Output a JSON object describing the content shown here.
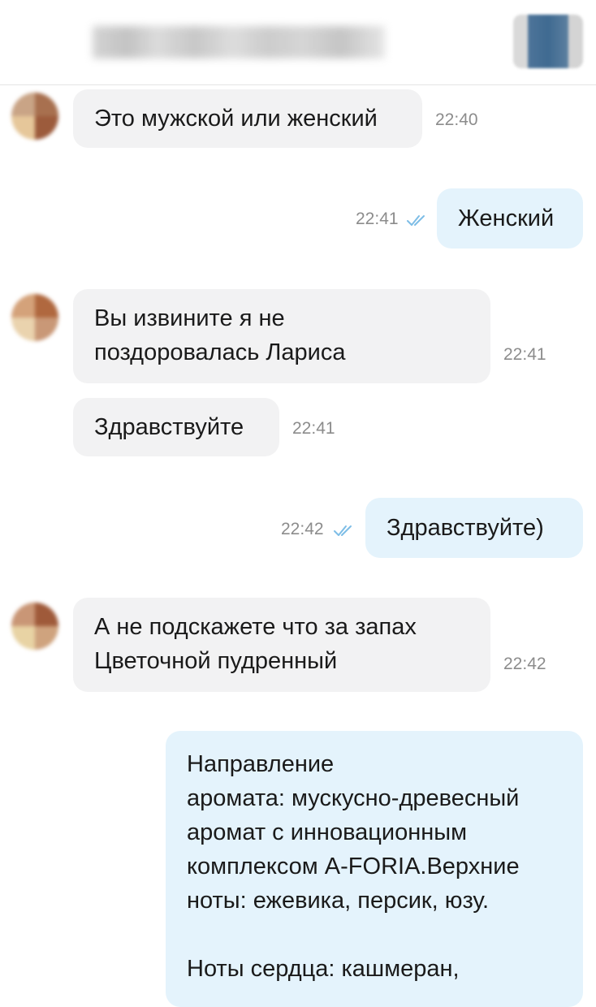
{
  "header": {
    "title_blurred": "",
    "avatar": "blurred-contact-avatar"
  },
  "messages": [
    {
      "id": "m1",
      "direction": "in",
      "text": "Это мужской или женский",
      "time": "22:40"
    },
    {
      "id": "m2",
      "direction": "out",
      "text": "Женский",
      "time": "22:41",
      "read_icon": "double-check-icon"
    },
    {
      "id": "m3",
      "direction": "in",
      "text": "Вы извините я не\nпоздоровалась Лариса",
      "time": "22:41"
    },
    {
      "id": "m4",
      "direction": "in",
      "text": "Здравствуйте",
      "time": "22:41"
    },
    {
      "id": "m5",
      "direction": "out",
      "text": "Здравствуйте)",
      "time": "22:42",
      "read_icon": "double-check-icon"
    },
    {
      "id": "m6",
      "direction": "in",
      "text": "А не подскажете что за запах\nЦветочной пудренный",
      "time": "22:42"
    },
    {
      "id": "m7",
      "direction": "out",
      "text": "Направление\nаромата: мускусно-древесный\nаромат с инновационным\nкомплексом A-FORIA.Верхние\nноты: ежевика, персик, юзу.\n\nНоты сердца: кашмеран,",
      "time": ""
    }
  ],
  "colors": {
    "incoming_bubble": "#f2f2f3",
    "outgoing_bubble": "#e4f3fc",
    "time_text": "#8c8c8c",
    "read_check": "#7dbde6"
  }
}
